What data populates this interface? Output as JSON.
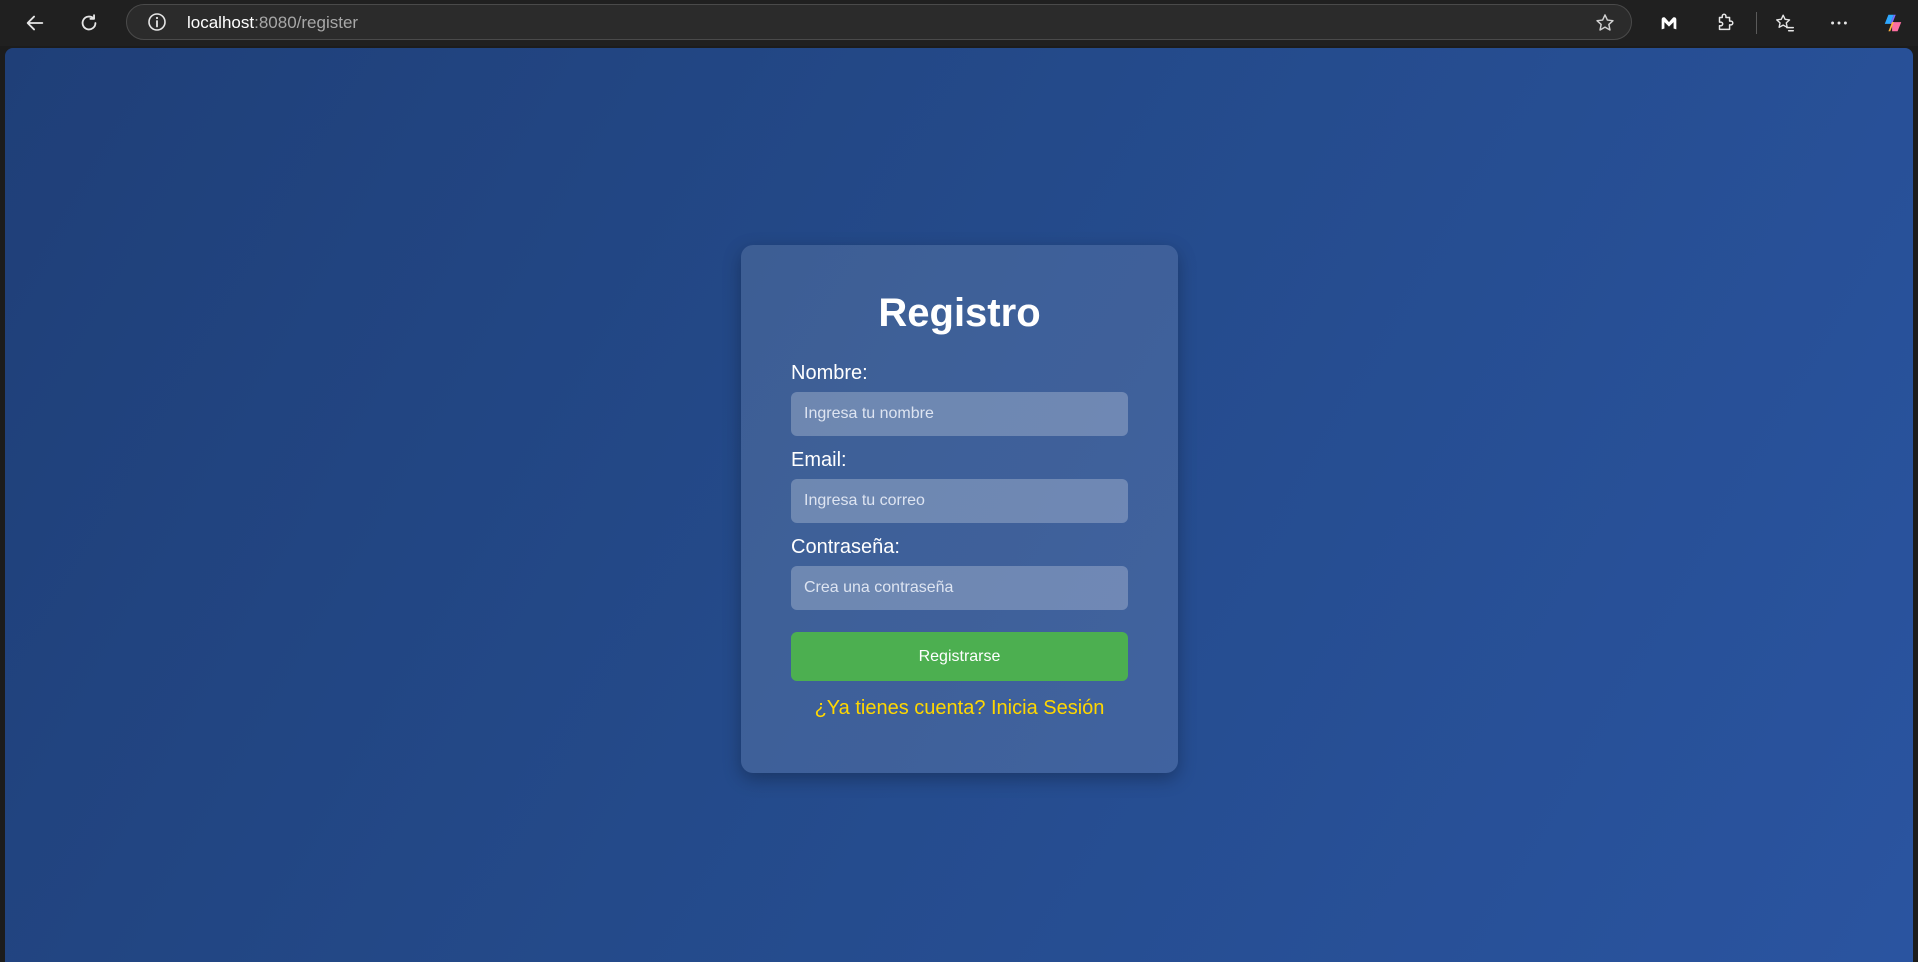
{
  "browser": {
    "url_host": "localhost",
    "url_rest": ":8080/register",
    "icons": [
      "back-arrow-icon",
      "refresh-icon",
      "info-icon",
      "star-icon",
      "malwarebytes-icon",
      "extensions-icon",
      "favorites-icon",
      "more-icon",
      "copilot-icon"
    ]
  },
  "form": {
    "title": "Registro",
    "name_label": "Nombre:",
    "name_placeholder": "Ingresa tu nombre",
    "name_value": "",
    "email_label": "Email:",
    "email_placeholder": "Ingresa tu correo",
    "email_value": "",
    "password_label": "Contraseña:",
    "password_placeholder": "Crea una contraseña",
    "password_value": "",
    "submit_label": "Registrarse",
    "login_link": "¿Ya tienes cuenta? Inicia Sesión"
  },
  "colors": {
    "background_start": "#1f3f78",
    "background_end": "#2a54a0",
    "button": "#4caf50",
    "link": "#ffd700"
  }
}
